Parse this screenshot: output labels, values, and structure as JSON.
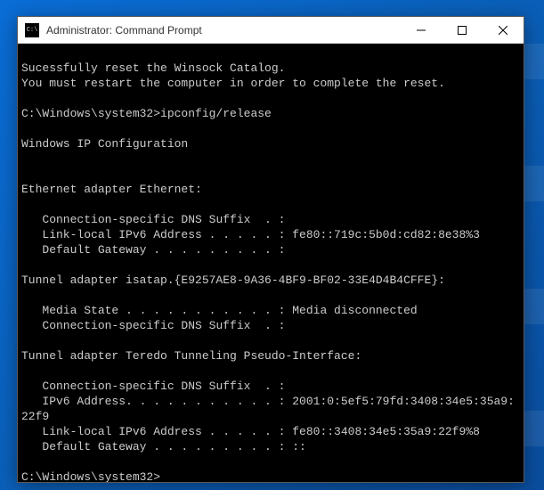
{
  "window": {
    "title": "Administrator: Command Prompt",
    "icon_label": "C:\\"
  },
  "terminal": {
    "lines": [
      "",
      "Sucessfully reset the Winsock Catalog.",
      "You must restart the computer in order to complete the reset.",
      "",
      "C:\\Windows\\system32>ipconfig/release",
      "",
      "Windows IP Configuration",
      "",
      "",
      "Ethernet adapter Ethernet:",
      "",
      "   Connection-specific DNS Suffix  . :",
      "   Link-local IPv6 Address . . . . . : fe80::719c:5b0d:cd82:8e38%3",
      "   Default Gateway . . . . . . . . . :",
      "",
      "Tunnel adapter isatap.{E9257AE8-9A36-4BF9-BF02-33E4D4B4CFFE}:",
      "",
      "   Media State . . . . . . . . . . . : Media disconnected",
      "   Connection-specific DNS Suffix  . :",
      "",
      "Tunnel adapter Teredo Tunneling Pseudo-Interface:",
      "",
      "   Connection-specific DNS Suffix  . :",
      "   IPv6 Address. . . . . . . . . . . : 2001:0:5ef5:79fd:3408:34e5:35a9:22f9",
      "   Link-local IPv6 Address . . . . . : fe80::3408:34e5:35a9:22f9%8",
      "   Default Gateway . . . . . . . . . : ::",
      ""
    ],
    "prompt": "C:\\Windows\\system32>"
  }
}
